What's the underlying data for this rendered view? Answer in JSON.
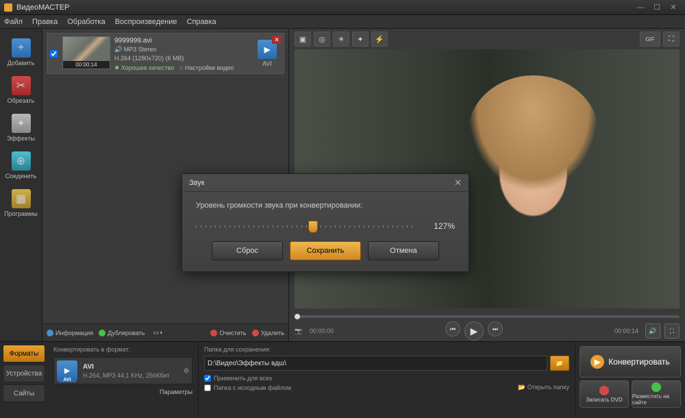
{
  "app": {
    "title": "ВидеоМАСТЕР"
  },
  "menu": {
    "file": "Файл",
    "edit": "Правка",
    "proc": "Обработка",
    "play": "Воспроизведение",
    "help": "Справка"
  },
  "sidebar": {
    "add": "Добавить",
    "cut": "Обрезать",
    "fx": "Эффекты",
    "join": "Соединить",
    "prog": "Программы"
  },
  "item": {
    "filename": "9999999.avi",
    "audio": "MP3 Stereo",
    "codec": "H.264 (1280x720) (6 MB)",
    "duration": "00:00:14",
    "quality": "Хорошее качество",
    "settings": "Настройки видео",
    "format": "AVI"
  },
  "listfoot": {
    "info": "Информация",
    "dup": "Дублировать",
    "clear": "Очистить",
    "del": "Удалить"
  },
  "preview": {
    "time_start": "00:00:00",
    "time_end": "00:00:14",
    "gif": "GIF"
  },
  "bottom": {
    "tabs": {
      "formats": "Форматы",
      "devices": "Устройства",
      "sites": "Сайты"
    },
    "convert_to": "Конвертировать в формат:",
    "format_name": "AVI",
    "format_sub": "H.264, MP3\n44,1 KHz, 256Кбит",
    "params": "Параметры",
    "save_folder": "Папка для сохранения:",
    "path": "D:\\Видео\\Эффекты вдш\\",
    "apply_all": "Применить для всех",
    "same_folder": "Папка с исходным файлом",
    "open_folder": "Открыть папку",
    "convert": "Конвертировать",
    "burn": "Записать DVD",
    "upload": "Разместить на сайте"
  },
  "dialog": {
    "title": "Звук",
    "label": "Уровень громкости звука при конвертировании:",
    "value": "127%",
    "reset": "Сброс",
    "save": "Сохранить",
    "cancel": "Отмена"
  }
}
